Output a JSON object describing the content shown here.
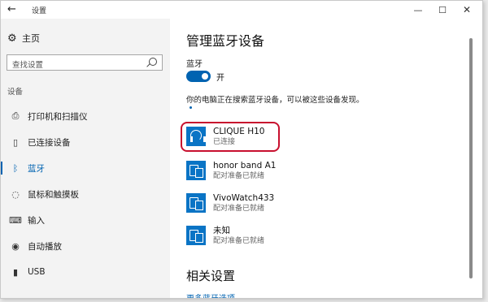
{
  "window": {
    "title": "设置",
    "back_icon": "back-arrow-icon"
  },
  "sidebar": {
    "home_label": "主页",
    "search_placeholder": "查找设置",
    "section_label": "设备",
    "items": [
      {
        "label": "打印机和扫描仪",
        "icon": "printer-icon"
      },
      {
        "label": "已连接设备",
        "icon": "connected-devices-icon"
      },
      {
        "label": "蓝牙",
        "icon": "bluetooth-icon",
        "active": true
      },
      {
        "label": "鼠标和触摸板",
        "icon": "mouse-icon"
      },
      {
        "label": "输入",
        "icon": "keyboard-icon"
      },
      {
        "label": "自动播放",
        "icon": "autoplay-icon"
      },
      {
        "label": "USB",
        "icon": "usb-icon"
      }
    ]
  },
  "main": {
    "heading": "管理蓝牙设备",
    "bluetooth_label": "蓝牙",
    "toggle_state": "开",
    "search_status": "你的电脑正在搜索蓝牙设备，可以被这些设备发现。",
    "devices": [
      {
        "name": "CLIQUE H10",
        "status": "已连接",
        "icon": "headset-icon",
        "highlighted": true
      },
      {
        "name": "honor band A1",
        "status": "配对准备已就绪",
        "icon": "phone-device-icon"
      },
      {
        "name": "VivoWatch433",
        "status": "配对准备已就绪",
        "icon": "phone-device-icon"
      },
      {
        "name": "未知",
        "status": "配对准备已就绪",
        "icon": "phone-device-icon"
      }
    ],
    "related_heading": "相关设置",
    "related_link": "更多蓝牙选项"
  },
  "colors": {
    "accent": "#0063b1",
    "device_icon": "#0a74c5",
    "highlight": "#c8102e"
  }
}
